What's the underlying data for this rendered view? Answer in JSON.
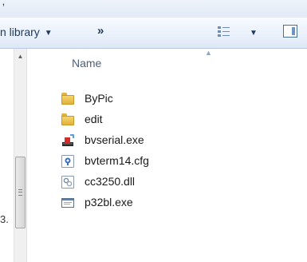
{
  "top_fragment": " ,",
  "toolbar": {
    "library_label": "n library",
    "library_caret": "▼",
    "more_label": "»",
    "views_caret": "▼",
    "icons": [
      "views-icon",
      "preview-pane-icon"
    ]
  },
  "nav_fragment": "3.",
  "scrollbar": {
    "up_arrow": "▲"
  },
  "columns": {
    "name": "Name",
    "sort_indicator": "▲"
  },
  "files": [
    {
      "name": "ByPic",
      "icon": "folder-icon"
    },
    {
      "name": "edit",
      "icon": "folder-icon"
    },
    {
      "name": "bvserial.exe",
      "icon": "executable-icon"
    },
    {
      "name": "bvterm14.cfg",
      "icon": "config-file-icon"
    },
    {
      "name": "cc3250.dll",
      "icon": "dll-file-icon"
    },
    {
      "name": "p32bl.exe",
      "icon": "window-app-icon"
    }
  ],
  "colors": {
    "toolbar_text": "#1e395b",
    "header_text": "#4c607a",
    "folder": "#e8c24e"
  }
}
